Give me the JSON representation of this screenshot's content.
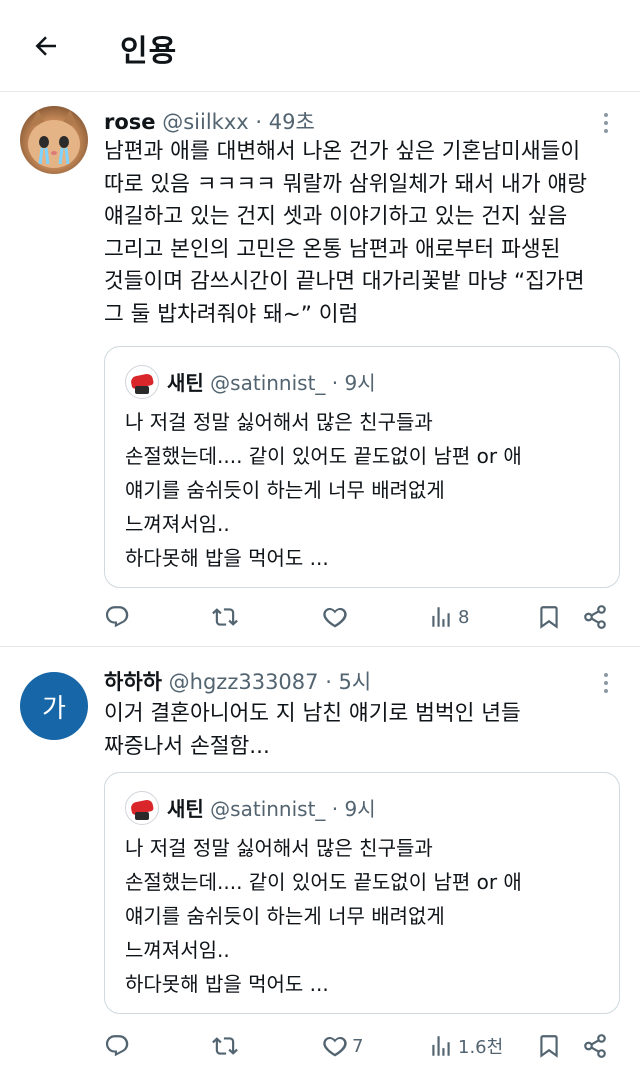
{
  "header": {
    "title": "인용"
  },
  "tweets": [
    {
      "name": "rose",
      "handle": "@siilkxx",
      "time": "· 49초",
      "text": "남편과 애를 대변해서 나온 건가 싶은 기혼남미새들이\n따로 있음 ㅋㅋㅋㅋ 뭐랄까 삼위일체가 돼서 내가 얘랑\n얘길하고 있는 건지 셋과 이야기하고 있는 건지 싶음\n그리고 본인의 고민은 온통 남편과 애로부터 파생된\n것들이며 감쓰시간이 끝나면 대가리꽃밭 마냥 “집가면\n그 둘 밥차려줘야 돼~” 이럼",
      "quote": {
        "name": "새틴",
        "handle": "@satinnist_",
        "time": "· 9시",
        "text": "나 저걸 정말 싫어해서 많은 친구들과\n손절했는데.... 같이 있어도 끝도없이 남편 or 애\n얘기를 숨쉬듯이 하는게 너무 배려없게\n느껴져서임..\n하다못해 밥을 먹어도 ..."
      },
      "stats": {
        "replies": "",
        "retweets": "",
        "likes": "",
        "views": "8"
      }
    },
    {
      "name": "하하하",
      "handle": "@hgzz333087",
      "time": "· 5시",
      "avatar_letter": "가",
      "text": "이거 결혼아니어도 지 남친 얘기로 범벅인 년들\n짜증나서 손절함...",
      "quote": {
        "name": "새틴",
        "handle": "@satinnist_",
        "time": "· 9시",
        "text": "나 저걸 정말 싫어해서 많은 친구들과\n손절했는데.... 같이 있어도 끝도없이 남편 or 애\n얘기를 숨쉬듯이 하는게 너무 배려없게\n느껴져서임..\n하다못해 밥을 먹어도 ..."
      },
      "stats": {
        "replies": "",
        "retweets": "",
        "likes": "7",
        "views": "1.6천"
      }
    }
  ],
  "icons": {
    "back": "arrow-left-icon",
    "more": "more-vertical-icon",
    "reply": "reply-icon",
    "retweet": "retweet-icon",
    "like": "heart-icon",
    "views": "views-icon",
    "bookmark": "bookmark-icon",
    "share": "share-icon"
  },
  "colors": {
    "text": "#0f1419",
    "secondary": "#536471",
    "avatar_bg": "#1666a8",
    "border": "#cfd9de"
  }
}
